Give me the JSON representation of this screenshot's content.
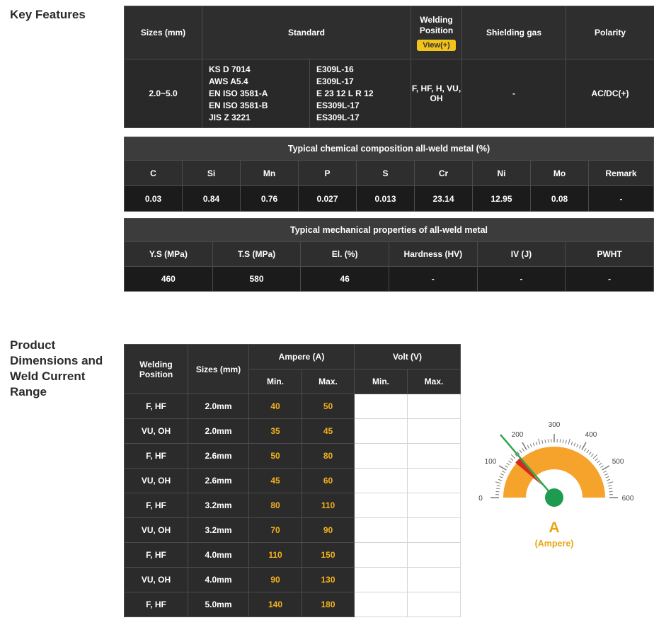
{
  "headings": {
    "key_features": "Key Features",
    "product_dimensions": "Product Dimensions and Weld Current Range"
  },
  "key_features": {
    "headers": {
      "sizes": "Sizes (mm)",
      "standard": "Standard",
      "welding_position": "Welding Position",
      "view_badge": "View(+)",
      "shielding_gas": "Shielding gas",
      "polarity": "Polarity"
    },
    "row": {
      "sizes": "2.0~5.0",
      "standard_specs": "KS D 7014\nAWS A5.4\nEN ISO 3581-A\nEN ISO 3581-B\nJIS Z 3221",
      "standard_classes": "E309L-16\nE309L-17\nE 23 12 L R 12\nES309L-17\nES309L-17",
      "welding_position": "F, HF, H, VU, OH",
      "shielding_gas": "-",
      "polarity": "AC/DC(+)"
    }
  },
  "chemical": {
    "title": "Typical chemical composition all-weld metal (%)",
    "columns": [
      "C",
      "Si",
      "Mn",
      "P",
      "S",
      "Cr",
      "Ni",
      "Mo",
      "Remark"
    ],
    "values": [
      "0.03",
      "0.84",
      "0.76",
      "0.027",
      "0.013",
      "23.14",
      "12.95",
      "0.08",
      "-"
    ]
  },
  "mechanical": {
    "title": "Typical mechanical properties of all-weld metal",
    "columns": [
      "Y.S (MPa)",
      "T.S (MPa)",
      "El. (%)",
      "Hardness (HV)",
      "IV (J)",
      "PWHT"
    ],
    "values": [
      "460",
      "580",
      "46",
      "-",
      "-",
      "-"
    ]
  },
  "current_range": {
    "headers": {
      "welding_position": "Welding Position",
      "sizes": "Sizes (mm)",
      "ampere": "Ampere (A)",
      "volt": "Volt (V)",
      "min": "Min.",
      "max": "Max."
    },
    "rows": [
      {
        "position": "F, HF",
        "size": "2.0mm",
        "amp_min": "40",
        "amp_max": "50",
        "volt_min": "",
        "volt_max": ""
      },
      {
        "position": "VU, OH",
        "size": "2.0mm",
        "amp_min": "35",
        "amp_max": "45",
        "volt_min": "",
        "volt_max": ""
      },
      {
        "position": "F, HF",
        "size": "2.6mm",
        "amp_min": "50",
        "amp_max": "80",
        "volt_min": "",
        "volt_max": ""
      },
      {
        "position": "VU, OH",
        "size": "2.6mm",
        "amp_min": "45",
        "amp_max": "60",
        "volt_min": "",
        "volt_max": ""
      },
      {
        "position": "F, HF",
        "size": "3.2mm",
        "amp_min": "80",
        "amp_max": "110",
        "volt_min": "",
        "volt_max": ""
      },
      {
        "position": "VU, OH",
        "size": "3.2mm",
        "amp_min": "70",
        "amp_max": "90",
        "volt_min": "",
        "volt_max": ""
      },
      {
        "position": "F, HF",
        "size": "4.0mm",
        "amp_min": "110",
        "amp_max": "150",
        "volt_min": "",
        "volt_max": ""
      },
      {
        "position": "VU, OH",
        "size": "4.0mm",
        "amp_min": "90",
        "amp_max": "130",
        "volt_min": "",
        "volt_max": ""
      },
      {
        "position": "F, HF",
        "size": "5.0mm",
        "amp_min": "140",
        "amp_max": "180",
        "volt_min": "",
        "volt_max": ""
      }
    ]
  },
  "gauge": {
    "unit": "A",
    "unit_caption": "(Ampere)",
    "min": 0,
    "max": 600,
    "tick_labels": [
      "0",
      "100",
      "200",
      "300",
      "400",
      "500",
      "600"
    ],
    "needle_value": 165,
    "alert_from": 140,
    "alert_to": 162,
    "colors": {
      "band": "#F5A32B",
      "needle": "#2BA84A",
      "hub": "#1D9B4E",
      "alert": "#D2281E",
      "unit_label": "#E9A511"
    }
  }
}
